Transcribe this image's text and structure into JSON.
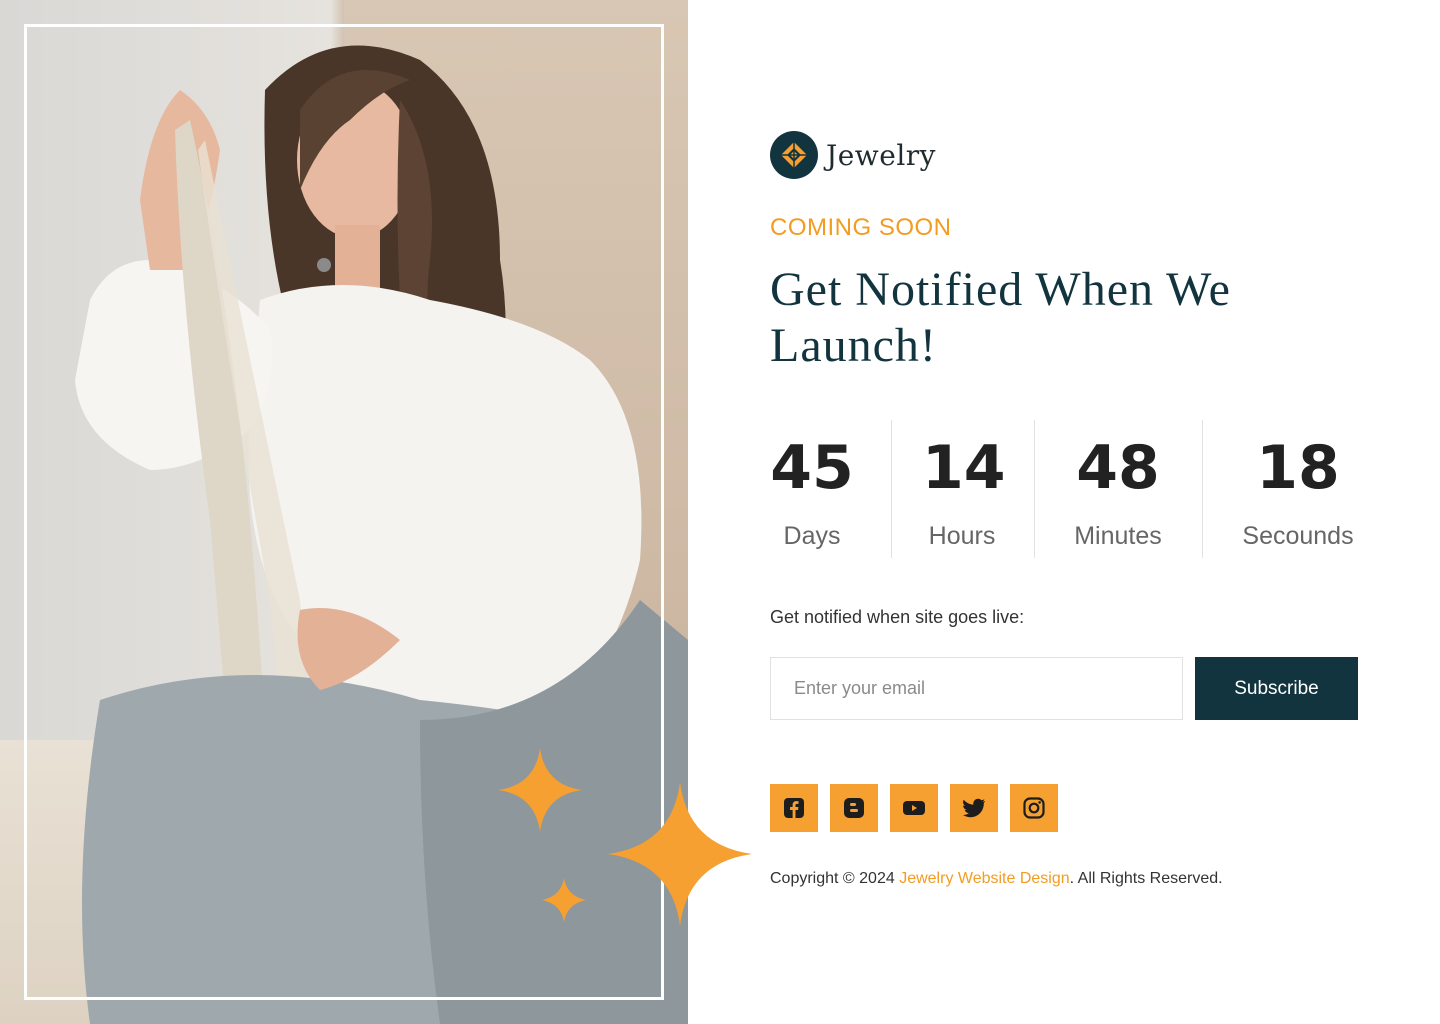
{
  "brand": {
    "name": "Jewelry",
    "icon": "diamond-logo-icon"
  },
  "hero": {
    "eyebrow": "COMING SOON",
    "headline": "Get Notified When We Launch!"
  },
  "countdown": [
    {
      "value": "45",
      "label": "Days"
    },
    {
      "value": "14",
      "label": "Hours"
    },
    {
      "value": "48",
      "label": "Minutes"
    },
    {
      "value": "18",
      "label": "Secounds"
    }
  ],
  "notify": {
    "label": "Get notified when site goes live:",
    "placeholder": "Enter your email",
    "button": "Subscribe"
  },
  "socials": [
    {
      "icon": "facebook-icon"
    },
    {
      "icon": "blogger-icon"
    },
    {
      "icon": "youtube-icon"
    },
    {
      "icon": "twitter-icon"
    },
    {
      "icon": "instagram-icon"
    }
  ],
  "footer": {
    "prefix": "Copyright © 2024 ",
    "link": "Jewelry Website Design",
    "suffix": ". All Rights Reserved."
  },
  "colors": {
    "accent": "#f39c22",
    "primary": "#12343f"
  }
}
